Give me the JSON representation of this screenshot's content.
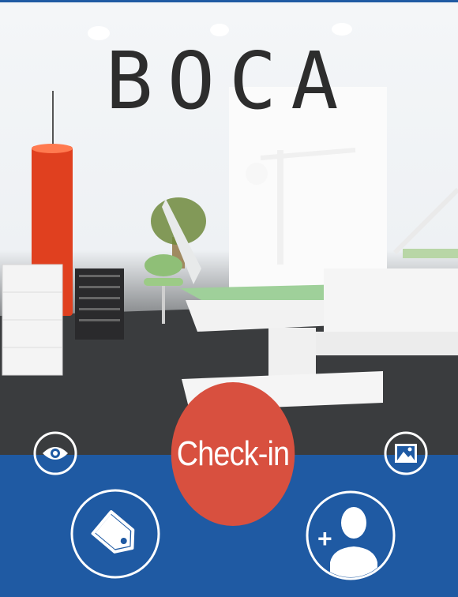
{
  "brand": {
    "logo_text": "BOCA"
  },
  "actions": {
    "checkin_label": "Check-in",
    "view_icon": "eye-icon",
    "gallery_icon": "image-icon",
    "tag_icon": "price-tag-icon",
    "add_user_icon": "add-user-icon"
  },
  "colors": {
    "panel_blue": "#1f5aa3",
    "checkin_red": "#d8503f",
    "icon_white": "#ffffff"
  }
}
